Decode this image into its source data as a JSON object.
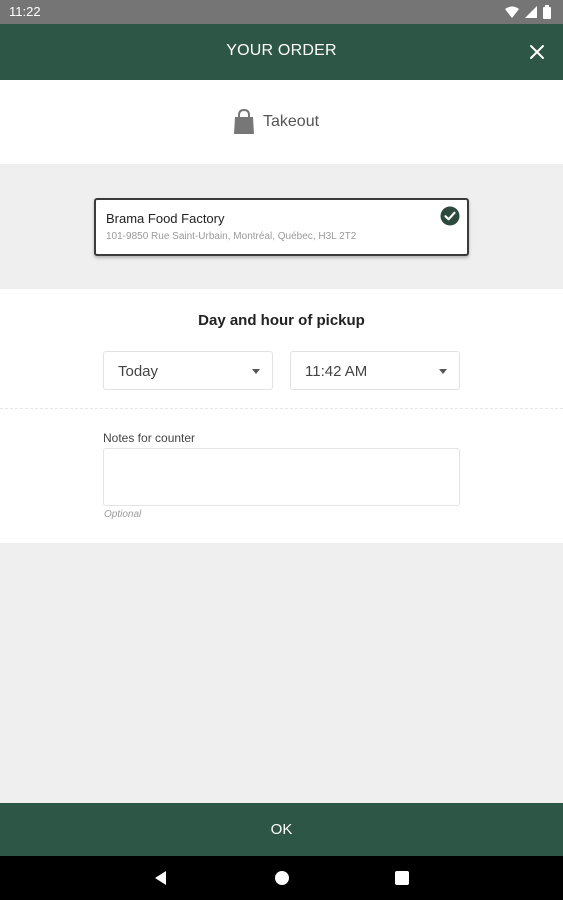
{
  "status_bar": {
    "time": "11:22",
    "icons": [
      "wifi-icon",
      "signal-icon",
      "battery-icon"
    ]
  },
  "header": {
    "title": "YOUR ORDER",
    "close_icon": "close-icon"
  },
  "order_mode": {
    "label": "Takeout",
    "icon": "shopping-bag-icon"
  },
  "store": {
    "name": "Brama Food Factory",
    "address": "101-9850 Rue Saint-Urbain, Montréal, Québec, H3L 2T2",
    "selected": true
  },
  "pickup": {
    "title": "Day and hour of pickup",
    "day": "Today",
    "time": "11:42 AM"
  },
  "notes": {
    "label": "Notes for counter",
    "value": "",
    "helper": "Optional"
  },
  "footer": {
    "ok_label": "OK"
  },
  "colors": {
    "primary": "#2d5646",
    "status_bar": "#757575",
    "background": "#efefef"
  }
}
